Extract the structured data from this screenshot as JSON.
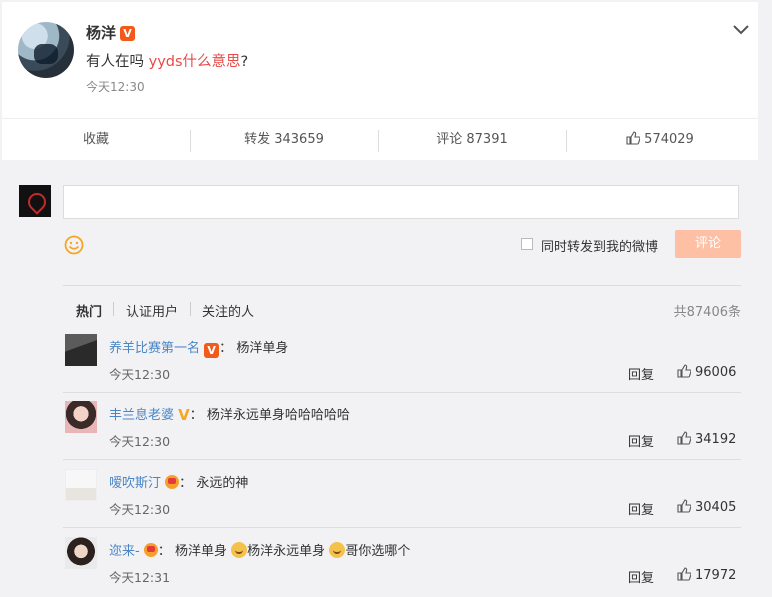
{
  "post": {
    "username": "杨洋",
    "text_prefix": "有人在吗 ",
    "text_link": "yyds什么意思",
    "text_suffix": "?",
    "time": "今天12:30",
    "v_badge": "V"
  },
  "actions": {
    "favorite": "收藏",
    "repost": "转发 343659",
    "comment": "评论 87391",
    "like": "574029"
  },
  "composer": {
    "input_placeholder": "",
    "repost_label": "同时转发到我的微博",
    "submit": "评论"
  },
  "tabs": {
    "hot": "热门",
    "verified": "认证用户",
    "following": "关注的人",
    "total": "共87406条"
  },
  "comments": [
    {
      "user": "养羊比赛第一名",
      "sep": "：",
      "text": "杨洋单身",
      "time": "今天12:30",
      "reply": "回复",
      "likes": "96006",
      "badge": "V"
    },
    {
      "user": "丰兰息老婆",
      "sep": "：",
      "text": "杨洋永远单身哈哈哈哈哈",
      "time": "今天12:30",
      "reply": "回复",
      "likes": "34192",
      "badge": "V"
    },
    {
      "user": "嗳吹斯汀",
      "sep": "：",
      "text": "永远的神",
      "time": "今天12:30",
      "reply": "回复",
      "likes": "30405"
    },
    {
      "user": "迩来-",
      "sep": "：",
      "text_a": "杨洋单身",
      "text_b": "杨洋永远单身",
      "text_c": "哥你选哪个",
      "time": "今天12:31",
      "reply": "回复",
      "likes": "17972"
    }
  ],
  "colors": {
    "accent": "#e64b47",
    "link": "#4a86c5",
    "badge": "#f25a1c",
    "submit": "#fdc0a5"
  }
}
